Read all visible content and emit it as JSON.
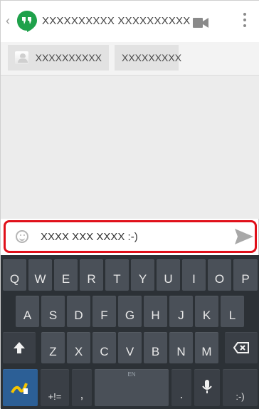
{
  "header": {
    "title": "XXXXXXXXXX XXXXXXXXXX",
    "icons": [
      "back-arrow-icon",
      "hangouts-icon",
      "video-call-icon",
      "overflow-menu-icon"
    ]
  },
  "participants": [
    {
      "name": "XXXXXXXXXX"
    },
    {
      "name": "XXXXXXXXX"
    }
  ],
  "compose": {
    "text": "XXXX XXX XXXX :-)",
    "highlight_color": "#e0101a"
  },
  "keyboard": {
    "row1": [
      {
        "main": "Q",
        "hint": ""
      },
      {
        "main": "W",
        "hint": ""
      },
      {
        "main": "E",
        "hint": ""
      },
      {
        "main": "R",
        "hint": ""
      },
      {
        "main": "T",
        "hint": ""
      },
      {
        "main": "Y",
        "hint": ""
      },
      {
        "main": "U",
        "hint": ""
      },
      {
        "main": "I",
        "hint": ""
      },
      {
        "main": "O",
        "hint": ""
      },
      {
        "main": "P",
        "hint": ""
      }
    ],
    "row2": [
      {
        "main": "A",
        "hint": ""
      },
      {
        "main": "S",
        "hint": ""
      },
      {
        "main": "D",
        "hint": ""
      },
      {
        "main": "F",
        "hint": ""
      },
      {
        "main": "G",
        "hint": ""
      },
      {
        "main": "H",
        "hint": ""
      },
      {
        "main": "J",
        "hint": ""
      },
      {
        "main": "K",
        "hint": ""
      },
      {
        "main": "L",
        "hint": ""
      }
    ],
    "row3": [
      {
        "main": "Z",
        "hint": ""
      },
      {
        "main": "X",
        "hint": ""
      },
      {
        "main": "C",
        "hint": ""
      },
      {
        "main": "V",
        "hint": ""
      },
      {
        "main": "B",
        "hint": ""
      },
      {
        "main": "N",
        "hint": ""
      },
      {
        "main": "M",
        "hint": ""
      }
    ],
    "bottom": {
      "symbols": "+!=",
      "comma": ",",
      "space": "EN",
      "period": ".",
      "enter": ":-)"
    }
  }
}
